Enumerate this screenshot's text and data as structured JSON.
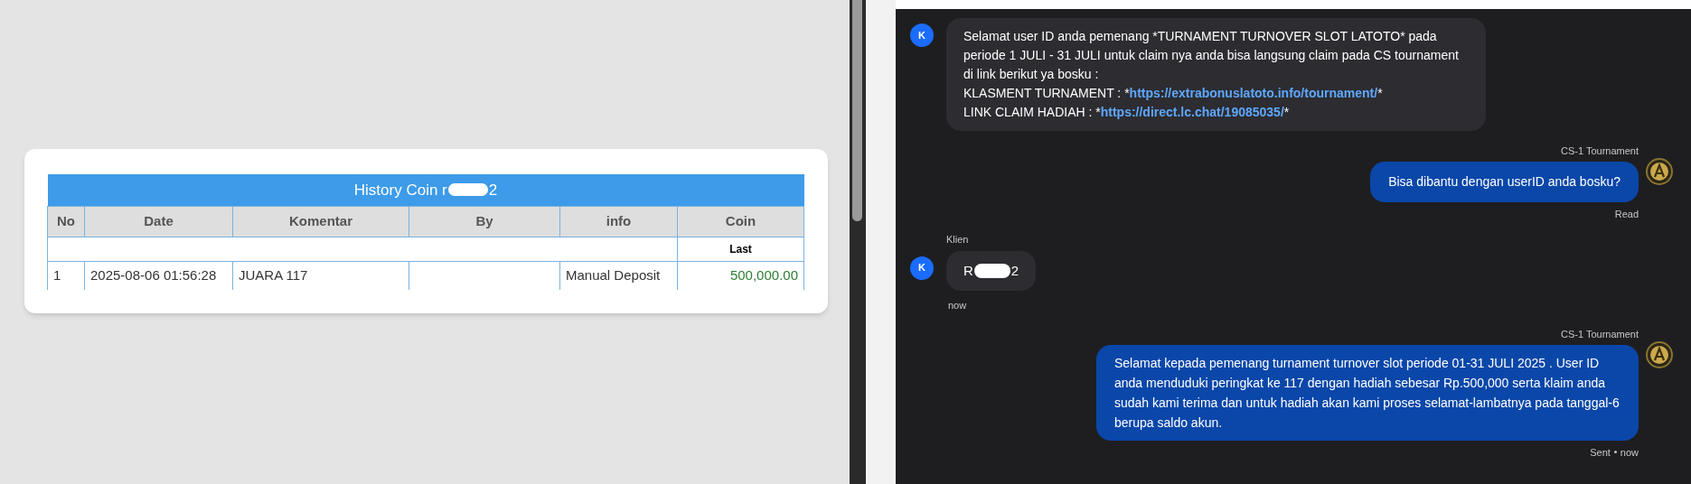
{
  "history_table": {
    "title_prefix": "History Coin r",
    "title_suffix": "2",
    "columns": [
      "No",
      "Date",
      "Komentar",
      "By",
      "info",
      "Coin"
    ],
    "subheader": "Last",
    "rows": [
      {
        "no": "1",
        "date": "2025-08-06 01:56:28",
        "komentar": "JUARA 117",
        "by": "",
        "info": "Manual Deposit",
        "coin": "500,000.00"
      }
    ]
  },
  "chat": {
    "messages": [
      {
        "kind": "incoming",
        "avatar": "K",
        "text": "Selamat user ID anda pemenang *TURNAMENT TURNOVER SLOT LATOTO* pada periode 1 JULI - 31 JULI untuk claim nya anda bisa langsung claim pada CS tournament di link berikut ya bosku :",
        "link_lines": [
          {
            "label": "KLASMENT TURNAMENT : *",
            "url": "https://extrabonuslatoto.info/tournament/",
            "after": "*"
          },
          {
            "label": "LINK CLAIM HADIAH : *",
            "url": "https://direct.lc.chat/19085035/",
            "after": "*"
          }
        ]
      },
      {
        "kind": "outgoing",
        "sender": "CS-1 Tournament",
        "text": "Bisa dibantu dengan userID anda bosku?",
        "status": "Read"
      },
      {
        "kind": "incoming",
        "avatar": "K",
        "sender": "Klien",
        "text_prefix": "R",
        "text_suffix": "2",
        "time": "now"
      },
      {
        "kind": "outgoing",
        "sender": "CS-1 Tournament",
        "text": "Selamat kepada pemenang turnament turnover slot periode 01-31 JULI 2025 . User ID anda menduduki peringkat ke 117 dengan hadiah sebesar Rp.500,000 serta klaim anda sudah kami terima dan untuk hadiah akan kami proses selamat-lambatnya pada tanggal-6 berupa saldo akun.",
        "status": "Sent",
        "time": "now"
      }
    ]
  }
}
